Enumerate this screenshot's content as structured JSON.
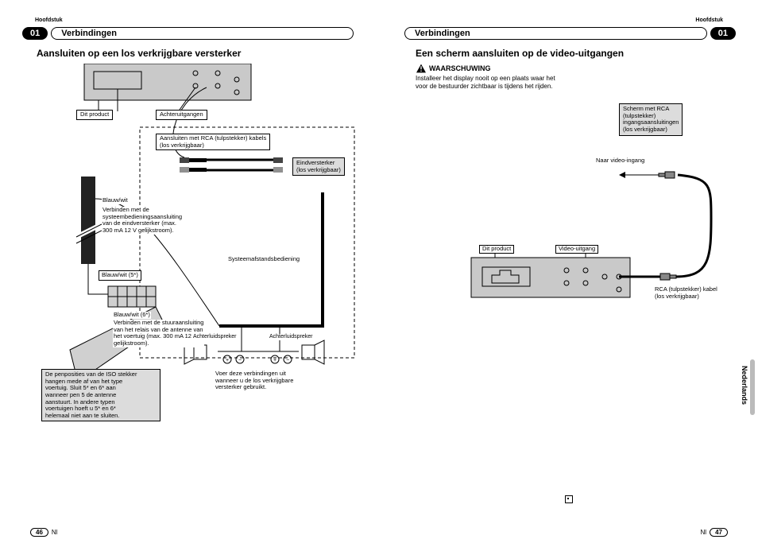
{
  "hoofdstuk": "Hoofdstuk",
  "chapter_num": "01",
  "section_title": "Verbindingen",
  "left": {
    "heading": "Aansluiten op een los verkrijgbare versterker",
    "labels": {
      "dit_product": "Dit product",
      "achteruitgangen": "Achteruitgangen",
      "rca_note": "Aansluiten met RCA (tulpstekker) kabels\n(los verkrijgbaar)",
      "eindversterker": "Eindversterker\n(los verkrijgbaar)",
      "systeem": "Systeemafstandsbediening",
      "blauwwit": "Blauw/wit",
      "blauwwit_desc": "Verbinden met de\nsysteembedieningsaansluiting\nvan de eindversterker (max.\n300 mA 12 V gelijkstroom).",
      "blauwwit5": "Blauw/wit (5*)",
      "blauwwit6": "Blauw/wit (6*)",
      "blauwwit6_desc": "Verbinden met de stuuraansluiting\nvan het relais van de antenne van\nhet voertuig (max. 300 mA 12 V\ngelijkstroom).",
      "iso_note": "De penposities van de ISO stekker\nhangen mede af van het type\nvoertuig. Sluit 5* en 6* aan\nwanneer pen 5 de antenne\naanstuurt. In andere typen\nvoertuigen hoeft u 5* en 6*\nhelemaal niet aan te sluiten.",
      "achterluidspreker": "Achterluidspreker",
      "voer_deze": "Voer deze verbindingen uit\nwanneer u de los verkrijgbare\nversterker gebruikt."
    },
    "pagenum": "46",
    "lang_code": "Nl"
  },
  "right": {
    "heading": "Een scherm aansluiten op de video-uitgangen",
    "warning_label": "WAARSCHUWING",
    "warning_body": "Installeer het display nooit op een plaats waar het\nvoor de bestuurder zichtbaar is tijdens het rijden.",
    "labels": {
      "scherm_box": "Scherm met RCA\n(tulpstekker)\ningangsaansluitingen\n(los verkrijgbaar)",
      "naar_video": "Naar video-ingang",
      "dit_product": "Dit product",
      "video_uitgang": "Video-uitgang",
      "rca_kabel": "RCA (tulpstekker) kabel\n(los verkrijgbaar)"
    },
    "language": "Nederlands",
    "pagenum": "47",
    "lang_code": "Nl"
  }
}
